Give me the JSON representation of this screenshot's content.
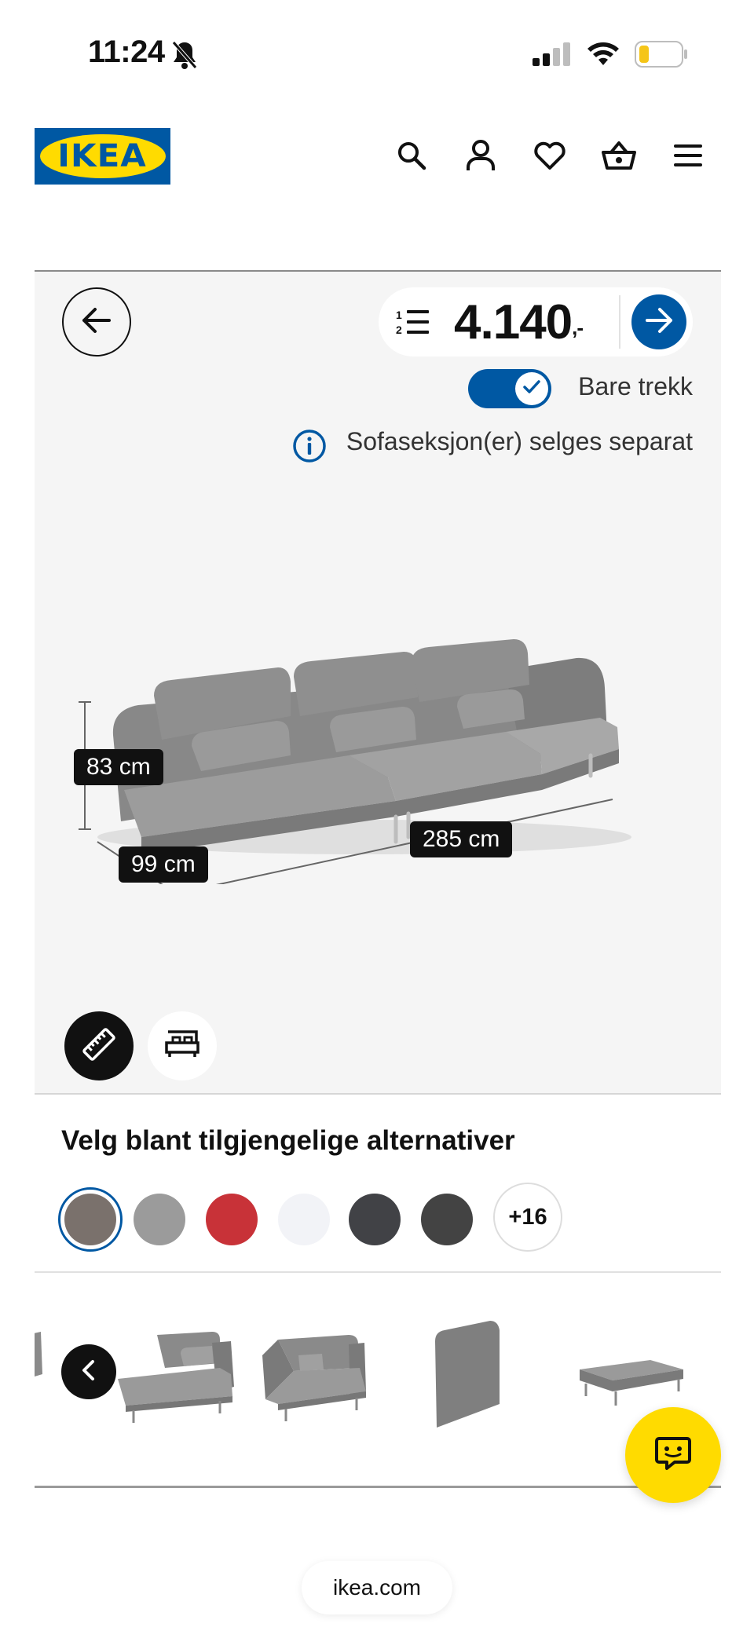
{
  "status_bar": {
    "time": "11:24",
    "battery_color": "#f5c518"
  },
  "header": {
    "logo_text": "IKEA",
    "icons": [
      "search-icon",
      "account-icon",
      "heart-icon",
      "basket-icon",
      "menu-icon"
    ],
    "brand_blue": "#0058a3",
    "brand_yellow": "#ffdb00"
  },
  "product": {
    "price": "4.140",
    "price_suffix": ",-",
    "toggle_label": "Bare trekk",
    "toggle_on": true,
    "info_text": "Sofaseksjon(er) selges separat",
    "dimensions": {
      "height": "83 cm",
      "depth": "99 cm",
      "width": "285 cm"
    }
  },
  "options": {
    "title": "Velg blant tilgjengelige alternativer",
    "swatches": [
      "#7a716c",
      "#9b9b9b",
      "#c83238",
      "#f2f3f7",
      "#414246",
      "#434343"
    ],
    "selected_index": 0,
    "more_label": "+16"
  },
  "carousel": {
    "items": [
      "chaise-longue-section",
      "corner-section",
      "backrest-cushion",
      "footstool"
    ]
  },
  "browser": {
    "url": "ikea.com"
  }
}
